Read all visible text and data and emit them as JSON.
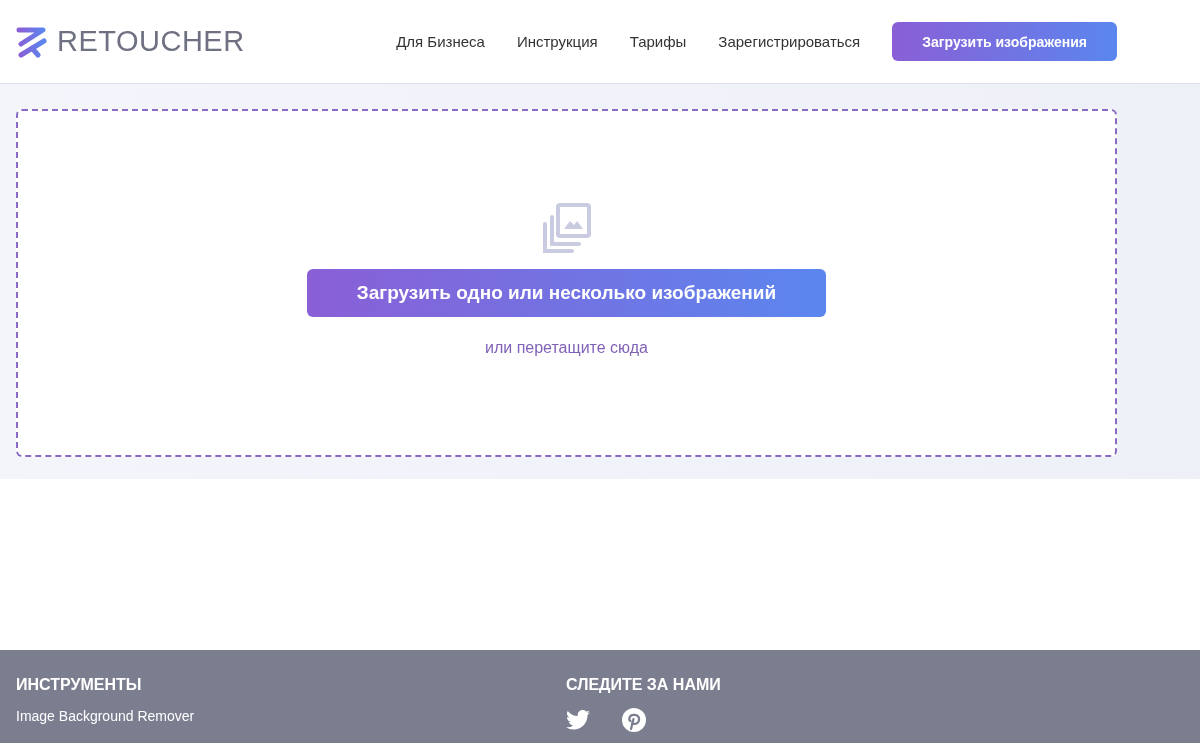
{
  "header": {
    "logo": "RETOUCHER",
    "nav": [
      "Для Бизнеса",
      "Инструкция",
      "Тарифы",
      "Зарегистрироваться"
    ],
    "cta": "Загрузить изображения"
  },
  "upload": {
    "button": "Загрузить одно или несколько изображений",
    "hint": "или перетащите сюда"
  },
  "footer": {
    "tools_title": "ИНСТРУМЕНТЫ",
    "tools": [
      "Image Background Remover"
    ],
    "follow_title": "СЛЕДИТЕ ЗА НАМИ"
  }
}
